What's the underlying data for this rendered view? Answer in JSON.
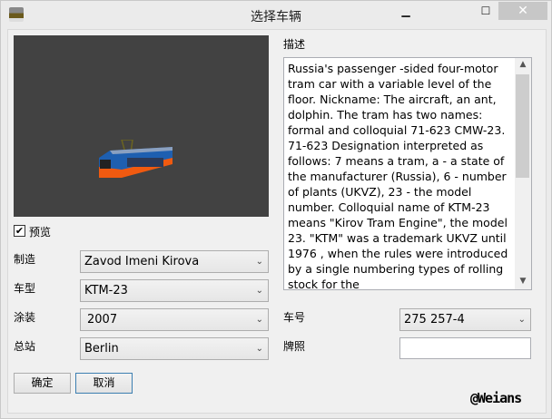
{
  "window": {
    "title": "选择车辆",
    "min": "▁",
    "max": "☐",
    "close": "✕"
  },
  "preview": {
    "checkbox_label": "预览",
    "checked": true,
    "check_mark": "✔"
  },
  "description": {
    "label": "描述",
    "text": "Russia's passenger -sided four-motor tram car with a variable level of the floor. Nickname: The aircraft, an ant, dolphin. The tram has two names: formal and colloquial 71-623 CMW-23. 71-623 Designation interpreted as follows: 7 means a tram, a - a state of the manufacturer (Russia), 6 - number of plants (UKVZ), 23 - the model number. Colloquial name of KTM-23 means \"Kirov Tram Engine\", the model 23. \"KTM\" was a trademark UKVZ until 1976 , when the rules were introduced by a single numbering types of rolling stock for the"
  },
  "fields": {
    "manufacturer": {
      "label": "制造",
      "value": "Zavod Imeni Kirova"
    },
    "model": {
      "label": "车型",
      "value": "KTM-23"
    },
    "livery": {
      "label": "涂装",
      "value": "2007"
    },
    "depot": {
      "label": "总站",
      "value": "Berlin"
    },
    "number": {
      "label": "车号",
      "value": "275 257-4"
    },
    "plate": {
      "label": "牌照",
      "value": ""
    }
  },
  "buttons": {
    "ok": "确定",
    "cancel": "取消"
  },
  "watermark": "@Weians",
  "arrow": "⌄"
}
